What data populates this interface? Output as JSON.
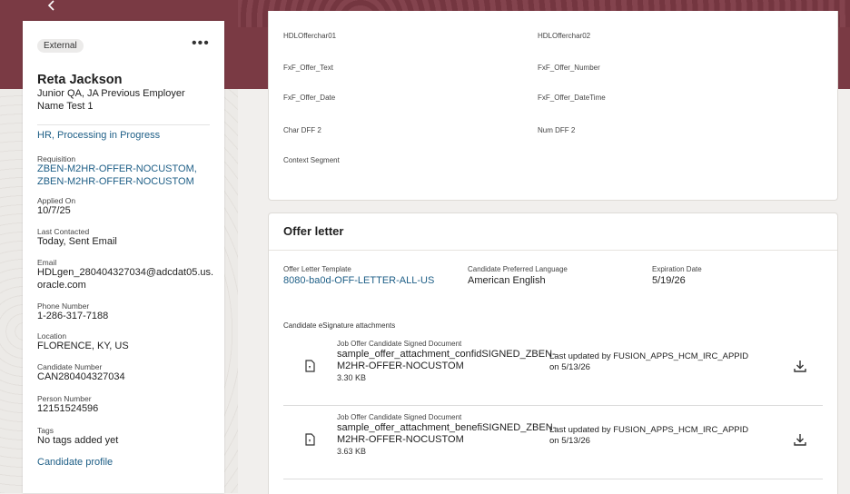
{
  "nav": {
    "back_icon": "chevron-left-icon"
  },
  "candidate": {
    "badge": "External",
    "more_icon": "more-horizontal-icon",
    "name": "Reta Jackson",
    "subtitle": "Junior QA, JA Previous Employer Name Test 1",
    "status": "HR, Processing in Progress",
    "fields": {
      "requisition": {
        "label": "Requisition",
        "value": "ZBEN-M2HR-OFFER-NOCUSTOM, ZBEN-M2HR-OFFER-NOCUSTOM"
      },
      "applied_on": {
        "label": "Applied On",
        "value": "10/7/25"
      },
      "last_contacted": {
        "label": "Last Contacted",
        "value": "Today, Sent Email"
      },
      "email": {
        "label": "Email",
        "value": "HDLgen_280404327034@adcdat05.us.oracle.com"
      },
      "phone": {
        "label": "Phone Number",
        "value": "1-286-317-7188"
      },
      "location": {
        "label": "Location",
        "value": "FLORENCE, KY, US"
      },
      "candidate_number": {
        "label": "Candidate Number",
        "value": "CAN280404327034"
      },
      "person_number": {
        "label": "Person Number",
        "value": "12151524596"
      },
      "tags": {
        "label": "Tags",
        "value": "No tags added yet"
      }
    },
    "profile_link": "Candidate profile"
  },
  "dff_panel": {
    "labels": [
      "HDLOfferchar01",
      "HDLOfferchar02",
      "FxF_Offer_Text",
      "FxF_Offer_Number",
      "FxF_Offer_Date",
      "FxF_Offer_DateTime",
      "Char DFF 2",
      "Num DFF 2",
      "Context Segment"
    ]
  },
  "offer_letter": {
    "title": "Offer letter",
    "template": {
      "label": "Offer Letter Template",
      "value": "8080-ba0d-OFF-LETTER-ALL-US"
    },
    "language": {
      "label": "Candidate Preferred Language",
      "value": "American English"
    },
    "expiration": {
      "label": "Expiration Date",
      "value": "5/19/26"
    },
    "attachments_header": "Candidate eSignature attachments",
    "attachments": [
      {
        "type": "Job Offer Candidate Signed Document",
        "name": "sample_offer_attachment_confidSIGNED_ZBEN-M2HR-OFFER-NOCUSTOM",
        "size": "3.30 KB",
        "updated": "Last updated by FUSION_APPS_HCM_IRC_APPID on 5/13/26",
        "file_icon": "document-icon",
        "download_icon": "download-icon"
      },
      {
        "type": "Job Offer Candidate Signed Document",
        "name": "sample_offer_attachment_benefiSIGNED_ZBEN-M2HR-OFFER-NOCUSTOM",
        "size": "3.63 KB",
        "updated": "Last updated by FUSION_APPS_HCM_IRC_APPID on 5/13/26",
        "file_icon": "document-icon",
        "download_icon": "download-icon"
      }
    ]
  }
}
